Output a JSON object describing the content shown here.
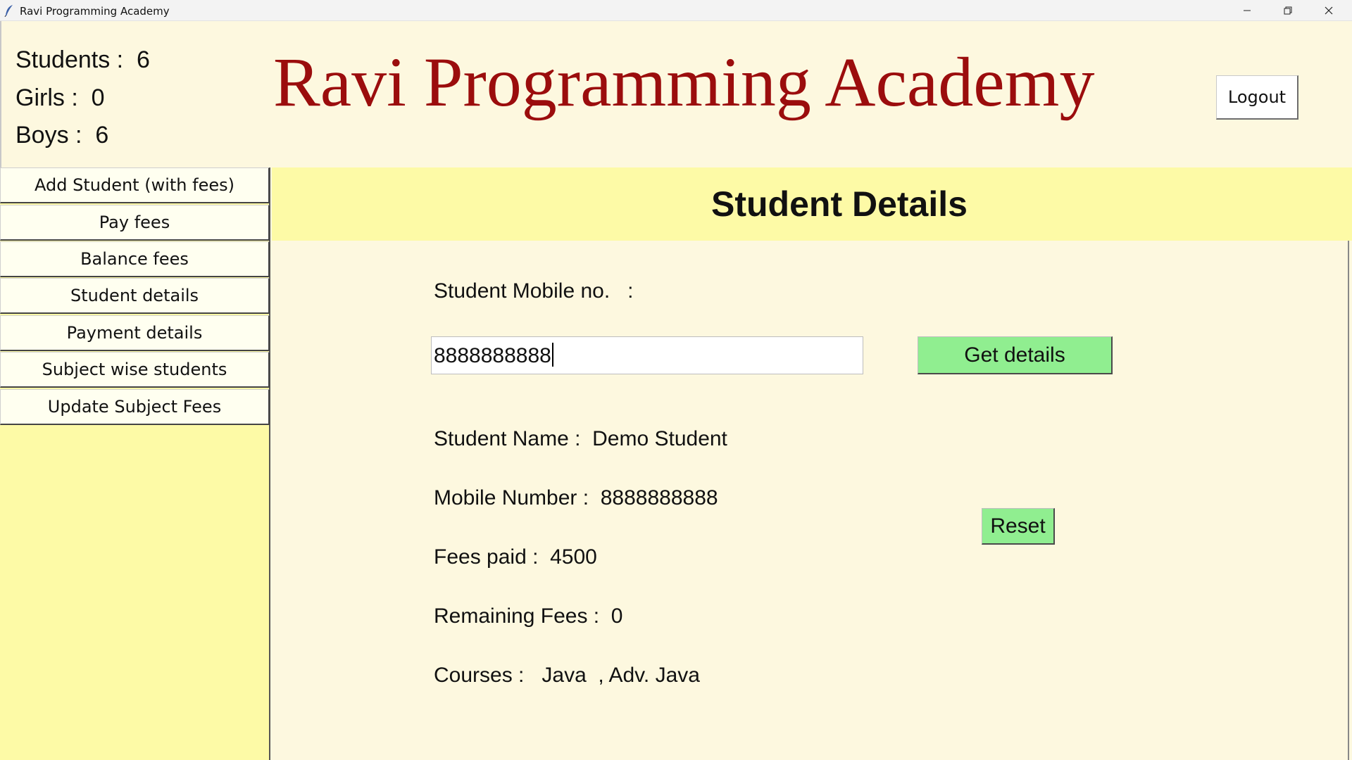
{
  "window": {
    "title": "Ravi Programming Academy",
    "minimize_icon": "minimize-icon",
    "maximize_icon": "restore-icon",
    "close_icon": "close-icon"
  },
  "stats": {
    "students": "Students :  6",
    "girls": "Girls :  0",
    "boys": "Boys :  6"
  },
  "brand_title": "Ravi Programming Academy",
  "logout_label": "Logout",
  "sidebar": {
    "items": [
      {
        "label": "Add Student (with fees)"
      },
      {
        "label": "Pay fees"
      },
      {
        "label": "Balance fees"
      },
      {
        "label": "Student details"
      },
      {
        "label": "Payment details"
      },
      {
        "label": "Subject wise students"
      },
      {
        "label": "Update Subject Fees"
      }
    ]
  },
  "main": {
    "title": "Student Details",
    "mobile_label": "Student Mobile no.   :",
    "mobile_value": "8888888888",
    "get_details_label": "Get details",
    "reset_label": "Reset",
    "details": {
      "name": "Student Name :  Demo Student",
      "mobile": "Mobile Number :  8888888888",
      "fees_paid": "Fees paid :  4500",
      "remaining": "Remaining Fees :  0",
      "courses": "Courses :   Java  , Adv. Java"
    }
  },
  "colors": {
    "brand": "#9b0d0d",
    "background": "#fdf8df",
    "panel": "#fdfaa6",
    "button_green": "#90ee90"
  }
}
